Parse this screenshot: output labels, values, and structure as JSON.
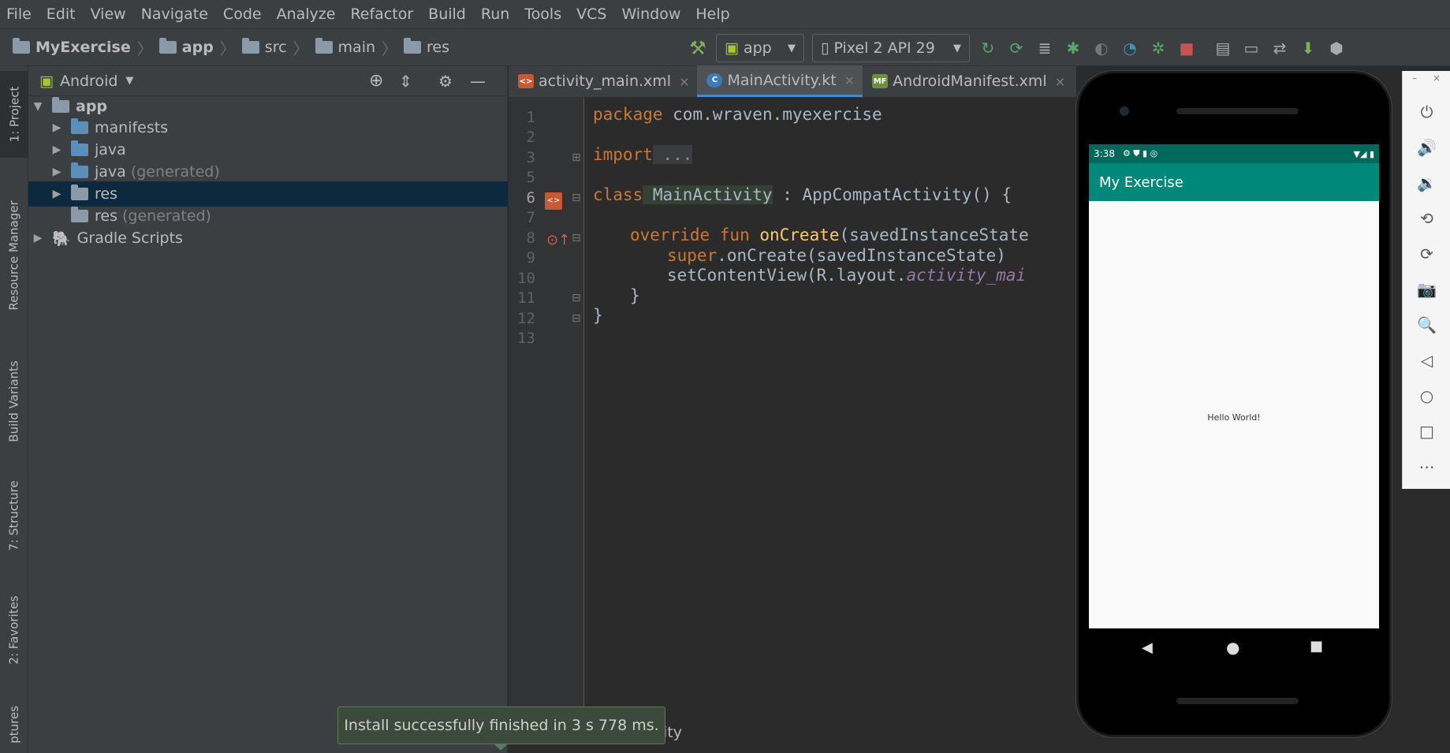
{
  "menu": [
    "File",
    "Edit",
    "View",
    "Navigate",
    "Code",
    "Analyze",
    "Refactor",
    "Build",
    "Run",
    "Tools",
    "VCS",
    "Window",
    "Help"
  ],
  "breadcrumb": [
    "MyExercise",
    "app",
    "src",
    "main",
    "res"
  ],
  "toolbar": {
    "run_config": "app",
    "device": "Pixel 2 API 29"
  },
  "left_strip": {
    "project": "1: Project",
    "resource_manager": "Resource Manager",
    "build_variants": "Build Variants",
    "structure": "7: Structure",
    "favorites": "2: Favorites",
    "captures": "ptures"
  },
  "project_panel": {
    "view_mode": "Android",
    "tree": [
      {
        "label": "app",
        "suffix": ""
      },
      {
        "label": "manifests",
        "suffix": ""
      },
      {
        "label": "java",
        "suffix": ""
      },
      {
        "label": "java",
        "suffix": "(generated)"
      },
      {
        "label": "res",
        "suffix": ""
      },
      {
        "label": "res",
        "suffix": "(generated)"
      },
      {
        "label": "Gradle Scripts",
        "suffix": ""
      }
    ]
  },
  "editor": {
    "tabs": [
      {
        "label": "activity_main.xml",
        "close": "×"
      },
      {
        "label": "MainActivity.kt",
        "close": "×"
      },
      {
        "label": "AndroidManifest.xml",
        "close": "×"
      }
    ],
    "line_numbers": [
      "1",
      "2",
      "3",
      "5",
      "6",
      "7",
      "8",
      "9",
      "10",
      "11",
      "12",
      "13"
    ],
    "code": {
      "l1_kw": "package",
      "l1_rest": " com.wraven.myexercise",
      "l3_kw": "import",
      "l3_rest": " ...",
      "l6_kw": "class",
      "l6_name": " MainActivity",
      "l6_rest": " : AppCompatActivity() {",
      "l8_kw": "override fun",
      "l8_fn": " onCreate",
      "l8_rest": "(savedInstanceState",
      "l9_kw": "super",
      "l9_rest": ".onCreate(savedInstanceState)",
      "l10_pre": "setContentView(R.layout.",
      "l10_it": "activity_mai",
      "l11": "}",
      "l12": "}"
    }
  },
  "emulator": {
    "time": "3:38",
    "app_title": "My Exercise",
    "content": "Hello World!"
  },
  "toast": "Install successfully finished in 3 s 778 ms.",
  "toast_tail": "ity"
}
